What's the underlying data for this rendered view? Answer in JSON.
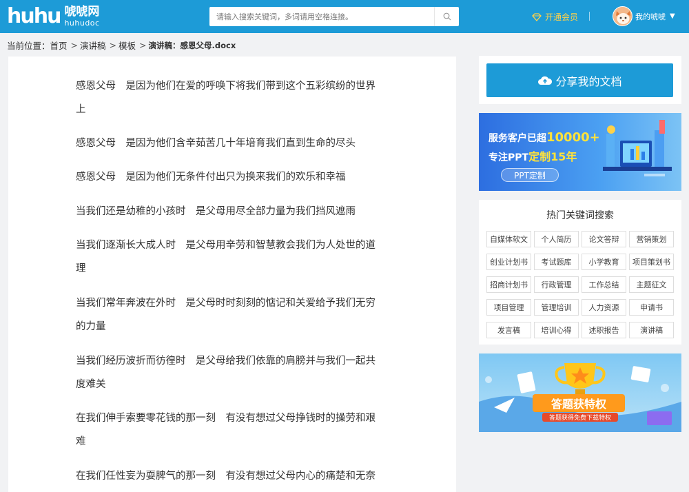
{
  "header": {
    "logo_mark": "huhu",
    "logo_cn": "唬唬网",
    "logo_en": "huhudoc",
    "search_placeholder": "请输入搜索关键词，多词请用空格连接。",
    "vip_label": "开通会员",
    "user_label": "我的唬唬",
    "accent_color": "#1d9bd7"
  },
  "breadcrumb": {
    "prefix": "当前位置：",
    "items": [
      "首页",
      "演讲稿",
      "模板"
    ],
    "current": "演讲稿：感恩父母.docx"
  },
  "document": {
    "lines": [
      "感恩父母　是因为他们在爱的呼唤下将我们带到这个五彩缤纷的世界",
      "上",
      "感恩父母　是因为他们含辛茹苦几十年培育我们直到生命的尽头",
      "感恩父母　是因为他们无条件付出只为换来我们的欢乐和幸福",
      "当我们还是幼稚的小孩时　是父母用尽全部力量为我们挡风遮雨",
      "当我们逐渐长大成人时　是父母用辛劳和智慧教会我们为人处世的道",
      "理",
      "当我们常年奔波在外时　是父母时时刻刻的惦记和关爱给予我们无穷",
      "的力量",
      "当我们经历波折而彷徨时　是父母给我们依靠的肩膀并与我们一起共",
      "度难关",
      "在我们伸手索要零花钱的那一刻　有没有想过父母挣钱时的操劳和艰",
      "难",
      "在我们任性妄为耍脾气的那一刻　有没有想过父母内心的痛楚和无奈"
    ]
  },
  "sidebar": {
    "share_label": "分享我的文档",
    "ad1": {
      "line1_prefix": "服务客户已超",
      "line1_highlight": "10000+",
      "line2_prefix": "专注PPT",
      "line2_highlight": "定制15年",
      "button": "PPT定制"
    },
    "keywords_title": "热门关键词搜索",
    "keywords": [
      "自媒体软文",
      "个人简历",
      "论文答辩",
      "营销策划",
      "创业计划书",
      "考试题库",
      "小学教育",
      "项目策划书",
      "招商计划书",
      "行政管理",
      "工作总结",
      "主题征文",
      "项目管理",
      "管理培训",
      "人力资源",
      "申请书",
      "发言稿",
      "培训心得",
      "述职报告",
      "演讲稿"
    ],
    "ad2": {
      "title": "答题获特权",
      "subtitle": "答题获得免费下载特权"
    }
  }
}
